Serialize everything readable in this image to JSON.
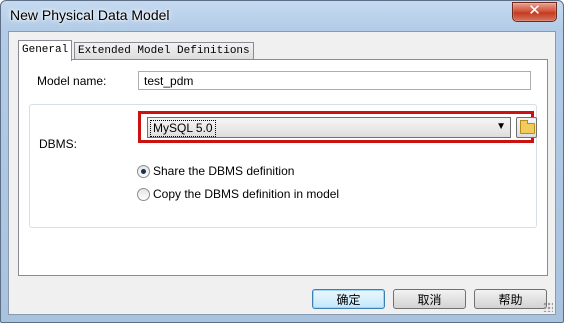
{
  "window": {
    "title": "New Physical Data Model",
    "close_symbol": "✕"
  },
  "tabs": [
    {
      "label": "General",
      "active": true
    },
    {
      "label": "Extended Model Definitions",
      "active": false
    }
  ],
  "general": {
    "model_name_label": "Model name:",
    "model_name_value": "test_pdm",
    "dbms_label": "DBMS:",
    "dbms_value": "MySQL 5.0",
    "radio_share_label": "Share the DBMS definition",
    "radio_copy_label": "Copy the DBMS definition in model",
    "selected_option": "share"
  },
  "buttons": {
    "ok": "确定",
    "cancel": "取消",
    "help": "帮助"
  },
  "colors": {
    "highlight": "#cc1111"
  }
}
